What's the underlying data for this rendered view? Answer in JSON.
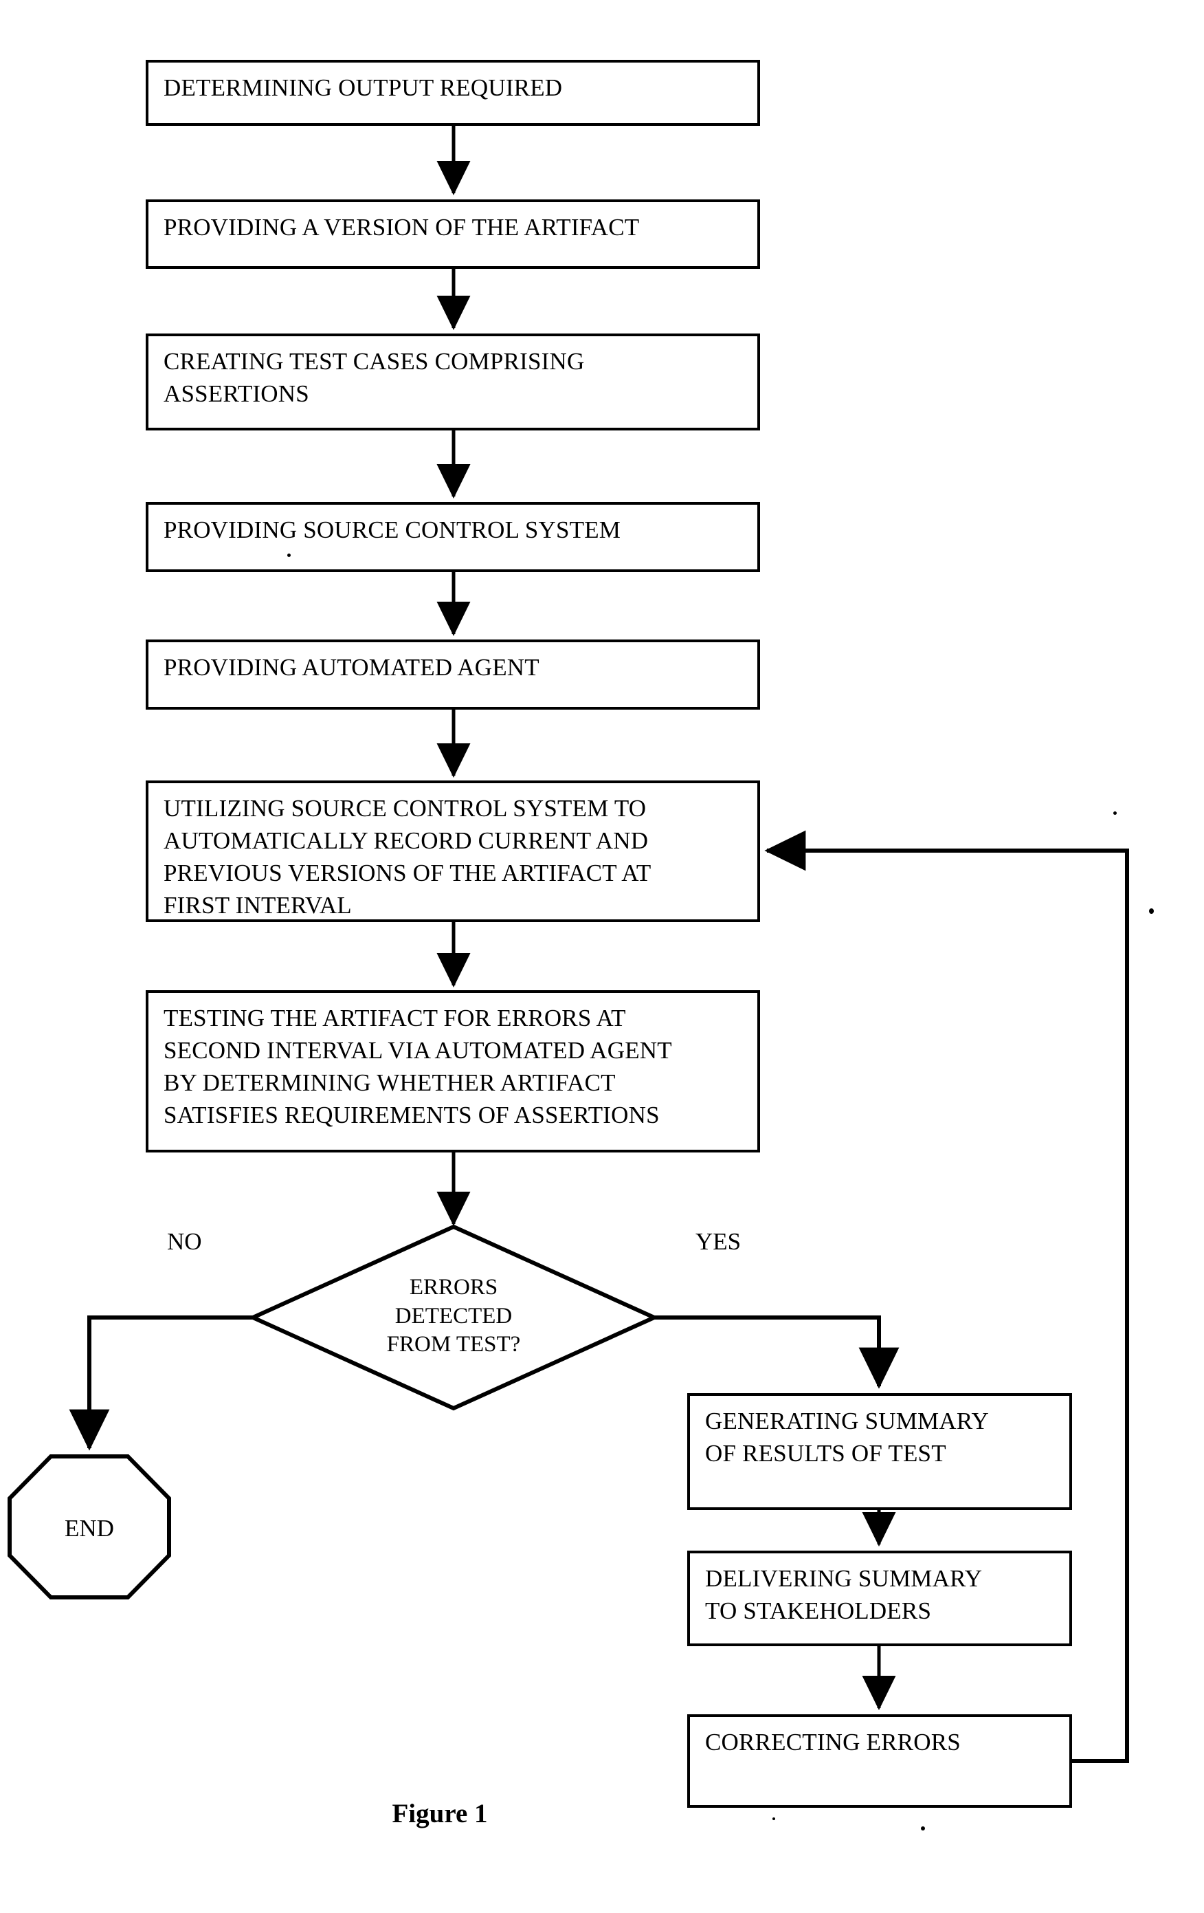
{
  "figure": {
    "caption": "Figure 1"
  },
  "diagram": {
    "type": "flowchart",
    "orientation": "top-to-bottom",
    "nodes": [
      {
        "id": "n1",
        "shape": "process",
        "label": "DETERMINING OUTPUT REQUIRED"
      },
      {
        "id": "n2",
        "shape": "process",
        "label": "PROVIDING A VERSION OF THE ARTIFACT"
      },
      {
        "id": "n3",
        "shape": "process",
        "label": "CREATING TEST CASES COMPRISING\nASSERTIONS"
      },
      {
        "id": "n4",
        "shape": "process",
        "label": "PROVIDING SOURCE CONTROL SYSTEM"
      },
      {
        "id": "n5",
        "shape": "process",
        "label": "PROVIDING AUTOMATED AGENT"
      },
      {
        "id": "n6",
        "shape": "process",
        "label": "UTILIZING SOURCE CONTROL SYSTEM TO\nAUTOMATICALLY RECORD CURRENT AND\nPREVIOUS VERSIONS OF THE ARTIFACT AT\nFIRST INTERVAL"
      },
      {
        "id": "n7",
        "shape": "process",
        "label": "TESTING THE ARTIFACT FOR ERRORS AT\nSECOND INTERVAL VIA AUTOMATED AGENT\nBY DETERMINING WHETHER ARTIFACT\nSATISFIES REQUIREMENTS OF ASSERTIONS"
      },
      {
        "id": "n8",
        "shape": "decision",
        "label": "ERRORS\nDETECTED\nFROM TEST?"
      },
      {
        "id": "n9",
        "shape": "terminator",
        "label": "END"
      },
      {
        "id": "n10",
        "shape": "process",
        "label": "GENERATING SUMMARY\nOF RESULTS OF TEST"
      },
      {
        "id": "n11",
        "shape": "process",
        "label": "DELIVERING SUMMARY\nTO STAKEHOLDERS"
      },
      {
        "id": "n12",
        "shape": "process",
        "label": "CORRECTING ERRORS"
      }
    ],
    "branch_labels": {
      "no": "NO",
      "yes": "YES"
    },
    "edges": [
      {
        "from": "n1",
        "to": "n2",
        "label": ""
      },
      {
        "from": "n2",
        "to": "n3",
        "label": ""
      },
      {
        "from": "n3",
        "to": "n4",
        "label": ""
      },
      {
        "from": "n4",
        "to": "n5",
        "label": ""
      },
      {
        "from": "n5",
        "to": "n6",
        "label": ""
      },
      {
        "from": "n6",
        "to": "n7",
        "label": ""
      },
      {
        "from": "n7",
        "to": "n8",
        "label": ""
      },
      {
        "from": "n8",
        "to": "n9",
        "label": "NO"
      },
      {
        "from": "n8",
        "to": "n10",
        "label": "YES"
      },
      {
        "from": "n10",
        "to": "n11",
        "label": ""
      },
      {
        "from": "n11",
        "to": "n12",
        "label": ""
      },
      {
        "from": "n12",
        "to": "n6",
        "label": ""
      }
    ]
  },
  "colors": {
    "stroke": "#000000",
    "fill": "#ffffff",
    "text": "#000000"
  }
}
